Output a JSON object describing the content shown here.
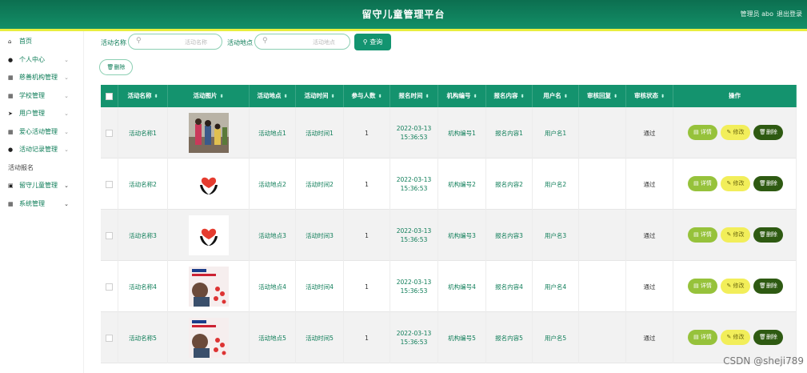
{
  "header": {
    "title": "留守儿童管理平台",
    "user": "管理员 abo",
    "logout": "退出登录"
  },
  "sidebar": {
    "items": [
      {
        "label": "首页",
        "icon": "home-icon",
        "chevron": false
      },
      {
        "label": "个人中心",
        "icon": "user-icon",
        "chevron": true
      },
      {
        "label": "慈善机构管理",
        "icon": "grid-icon",
        "chevron": true
      },
      {
        "label": "学校管理",
        "icon": "grid-icon",
        "chevron": true
      },
      {
        "label": "用户管理",
        "icon": "send-icon",
        "chevron": true
      },
      {
        "label": "爱心活动管理",
        "icon": "grid-icon",
        "chevron": true
      },
      {
        "label": "活动记录管理",
        "icon": "user-icon",
        "chevron": true
      },
      {
        "label": "活动报名",
        "icon": "",
        "chevron": false
      },
      {
        "label": "留守儿童管理",
        "icon": "doc-icon",
        "chevron": true
      },
      {
        "label": "系统管理",
        "icon": "grid-icon",
        "chevron": true
      }
    ]
  },
  "search": {
    "name_label": "活动名称",
    "name_placeholder": "活动名称",
    "place_label": "活动地点",
    "place_placeholder": "活动地点",
    "query_label": "查询",
    "delete_label": "删除"
  },
  "table": {
    "headers": [
      "活动名称",
      "活动图片",
      "活动地点",
      "活动时间",
      "参与人数",
      "报名时间",
      "机构编号",
      "报名内容",
      "用户名",
      "审核回复",
      "审核状态",
      "操作"
    ],
    "action_labels": {
      "detail": "详情",
      "edit": "修改",
      "delete": "删除"
    },
    "rows": [
      {
        "name": "活动名称1",
        "image": "photo",
        "place": "活动地点1",
        "time": "活动时间1",
        "count": "1",
        "signup_time": "2022-03-13 15:36:53",
        "org": "机构编号1",
        "content": "报名内容1",
        "user": "用户名1",
        "reply": "",
        "status": "通过"
      },
      {
        "name": "活动名称2",
        "image": "heart",
        "place": "活动地点2",
        "time": "活动时间2",
        "count": "1",
        "signup_time": "2022-03-13 15:36:53",
        "org": "机构编号2",
        "content": "报名内容2",
        "user": "用户名2",
        "reply": "",
        "status": "通过"
      },
      {
        "name": "活动名称3",
        "image": "heart",
        "place": "活动地点3",
        "time": "活动时间3",
        "count": "1",
        "signup_time": "2022-03-13 15:36:53",
        "org": "机构编号3",
        "content": "报名内容3",
        "user": "用户名3",
        "reply": "",
        "status": "通过"
      },
      {
        "name": "活动名称4",
        "image": "poster",
        "place": "活动地点4",
        "time": "活动时间4",
        "count": "1",
        "signup_time": "2022-03-13 15:36:53",
        "org": "机构编号4",
        "content": "报名内容4",
        "user": "用户名4",
        "reply": "",
        "status": "通过"
      },
      {
        "name": "活动名称5",
        "image": "poster",
        "place": "活动地点5",
        "time": "活动时间5",
        "count": "1",
        "signup_time": "2022-03-13 15:36:53",
        "org": "机构编号5",
        "content": "报名内容5",
        "user": "用户名5",
        "reply": "",
        "status": "通过"
      }
    ]
  },
  "watermark": "CSDN @sheji789",
  "colors": {
    "header": "#138f67",
    "accent_line": "#e9ee3e",
    "primary_text": "#0e7d58",
    "detail_btn": "#96c23b",
    "edit_btn": "#f2ee5a",
    "delete_btn": "#2e5a12"
  }
}
